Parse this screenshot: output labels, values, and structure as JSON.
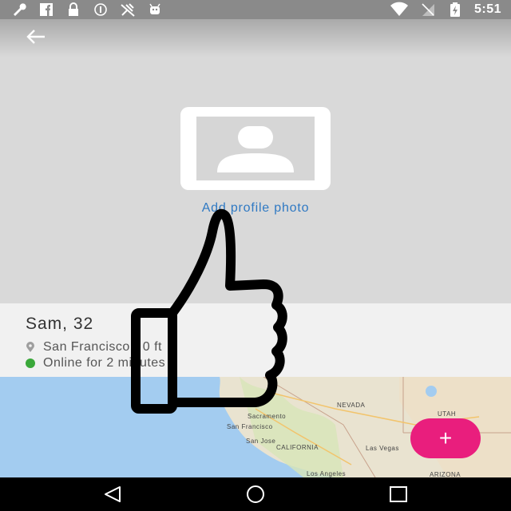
{
  "status_bar": {
    "time": "5:51",
    "left_icons": [
      "wrench-icon",
      "facebook-icon",
      "lock-icon",
      "info-icon",
      "no-signal-icon",
      "android-icon"
    ],
    "right_icons": [
      "wifi-icon",
      "no-sim-icon",
      "battery-charging-icon"
    ]
  },
  "toolbar": {
    "back_icon": "arrow-left-icon"
  },
  "profile": {
    "add_photo_label": "Add profile photo",
    "name": "Sam, 32",
    "location": "San Francisco • 0 ft",
    "online": "Online for 2 minutes"
  },
  "map": {
    "labels": {
      "nevada": "NEVADA",
      "utah": "UTAH",
      "sacramento": "Sacramento",
      "san_francisco": "San Francisco",
      "san_jose": "San Jose",
      "california": "CALIFORNIA",
      "las_vegas": "Las Vegas",
      "los_angeles": "Los Angeles",
      "arizona": "ARIZONA"
    }
  },
  "fab": {
    "label": "+"
  },
  "colors": {
    "accent": "#e91e7d",
    "link": "#2f79c3",
    "online": "#3aa83a"
  }
}
